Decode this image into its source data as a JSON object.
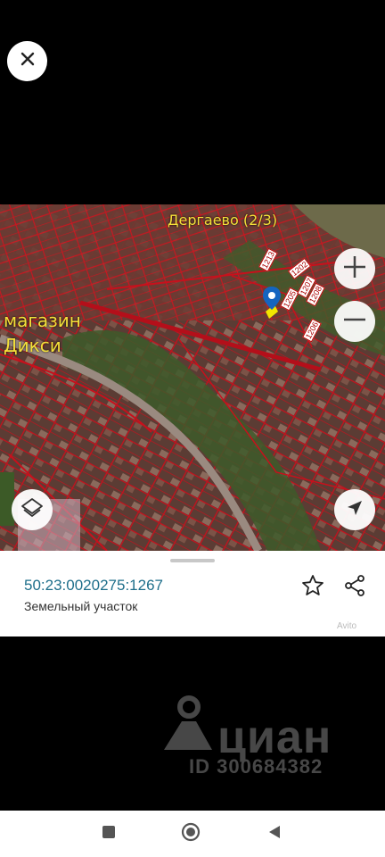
{
  "top": {
    "close_icon": "close-icon"
  },
  "map": {
    "labels": {
      "village": "Дергаево (2/3)",
      "shop": "магазин Дикси"
    },
    "plot_numbers": [
      "1213",
      "1202",
      "1205",
      "1207",
      "1208",
      "1206"
    ],
    "controls": {
      "zoom_in": "plus-icon",
      "zoom_out": "minus-icon",
      "layers": "layers-icon",
      "locate": "navigation-arrow-icon"
    },
    "colors": {
      "boundary": "#c8101c",
      "marker": "#1565c0",
      "highlight": "#f2e600"
    }
  },
  "sheet": {
    "cadastral_number": "50:23:0020275:1267",
    "object_type": "Земельный участок",
    "favorite_icon": "star-icon",
    "share_icon": "share-icon"
  },
  "watermark": {
    "brand": "циан",
    "listing_id": "ID 300684382",
    "avito": "Avito"
  },
  "navbar": {
    "recent": "square-icon",
    "home": "circle-icon",
    "back": "triangle-back-icon"
  }
}
